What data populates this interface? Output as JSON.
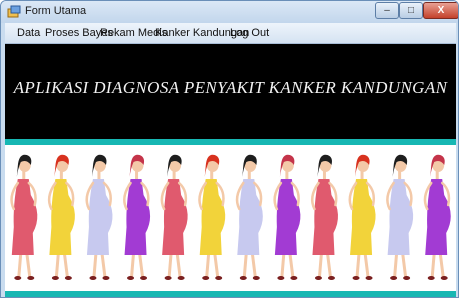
{
  "window": {
    "title": "Form Utama",
    "controls": {
      "minimize": "–",
      "maximize": "□",
      "close": "X"
    }
  },
  "menu": {
    "items": [
      {
        "label": "Data"
      },
      {
        "label": "Proses Bayes"
      },
      {
        "label": "Rekam Medis"
      },
      {
        "label": "Kanker Kandungan"
      },
      {
        "label": "Log Out"
      }
    ]
  },
  "banner": {
    "title": "APLIKASI DIAGNOSA PENYAKIT KANKER KANDUNGAN"
  },
  "illustration": {
    "description_icon": "pregnant-women-icon",
    "figures": [
      {
        "dress": "#e05a6e",
        "hair": "#1e1e1e"
      },
      {
        "dress": "#f2d33a",
        "hair": "#d8321f"
      },
      {
        "dress": "#c7c9ef",
        "hair": "#1e1e1e"
      },
      {
        "dress": "#a23bd3",
        "hair": "#c4344a"
      },
      {
        "dress": "#e05a6e",
        "hair": "#1e1e1e"
      },
      {
        "dress": "#f2d33a",
        "hair": "#d8321f"
      },
      {
        "dress": "#c7c9ef",
        "hair": "#1e1e1e"
      },
      {
        "dress": "#a23bd3",
        "hair": "#c4344a"
      },
      {
        "dress": "#e05a6e",
        "hair": "#1e1e1e"
      },
      {
        "dress": "#f2d33a",
        "hair": "#d8321f"
      },
      {
        "dress": "#c7c9ef",
        "hair": "#1e1e1e"
      },
      {
        "dress": "#a23bd3",
        "hair": "#c4344a"
      }
    ]
  },
  "colors": {
    "accent_stripe": "#17b7b3",
    "banner_bg": "#000000",
    "banner_text": "#f2f2f2"
  }
}
